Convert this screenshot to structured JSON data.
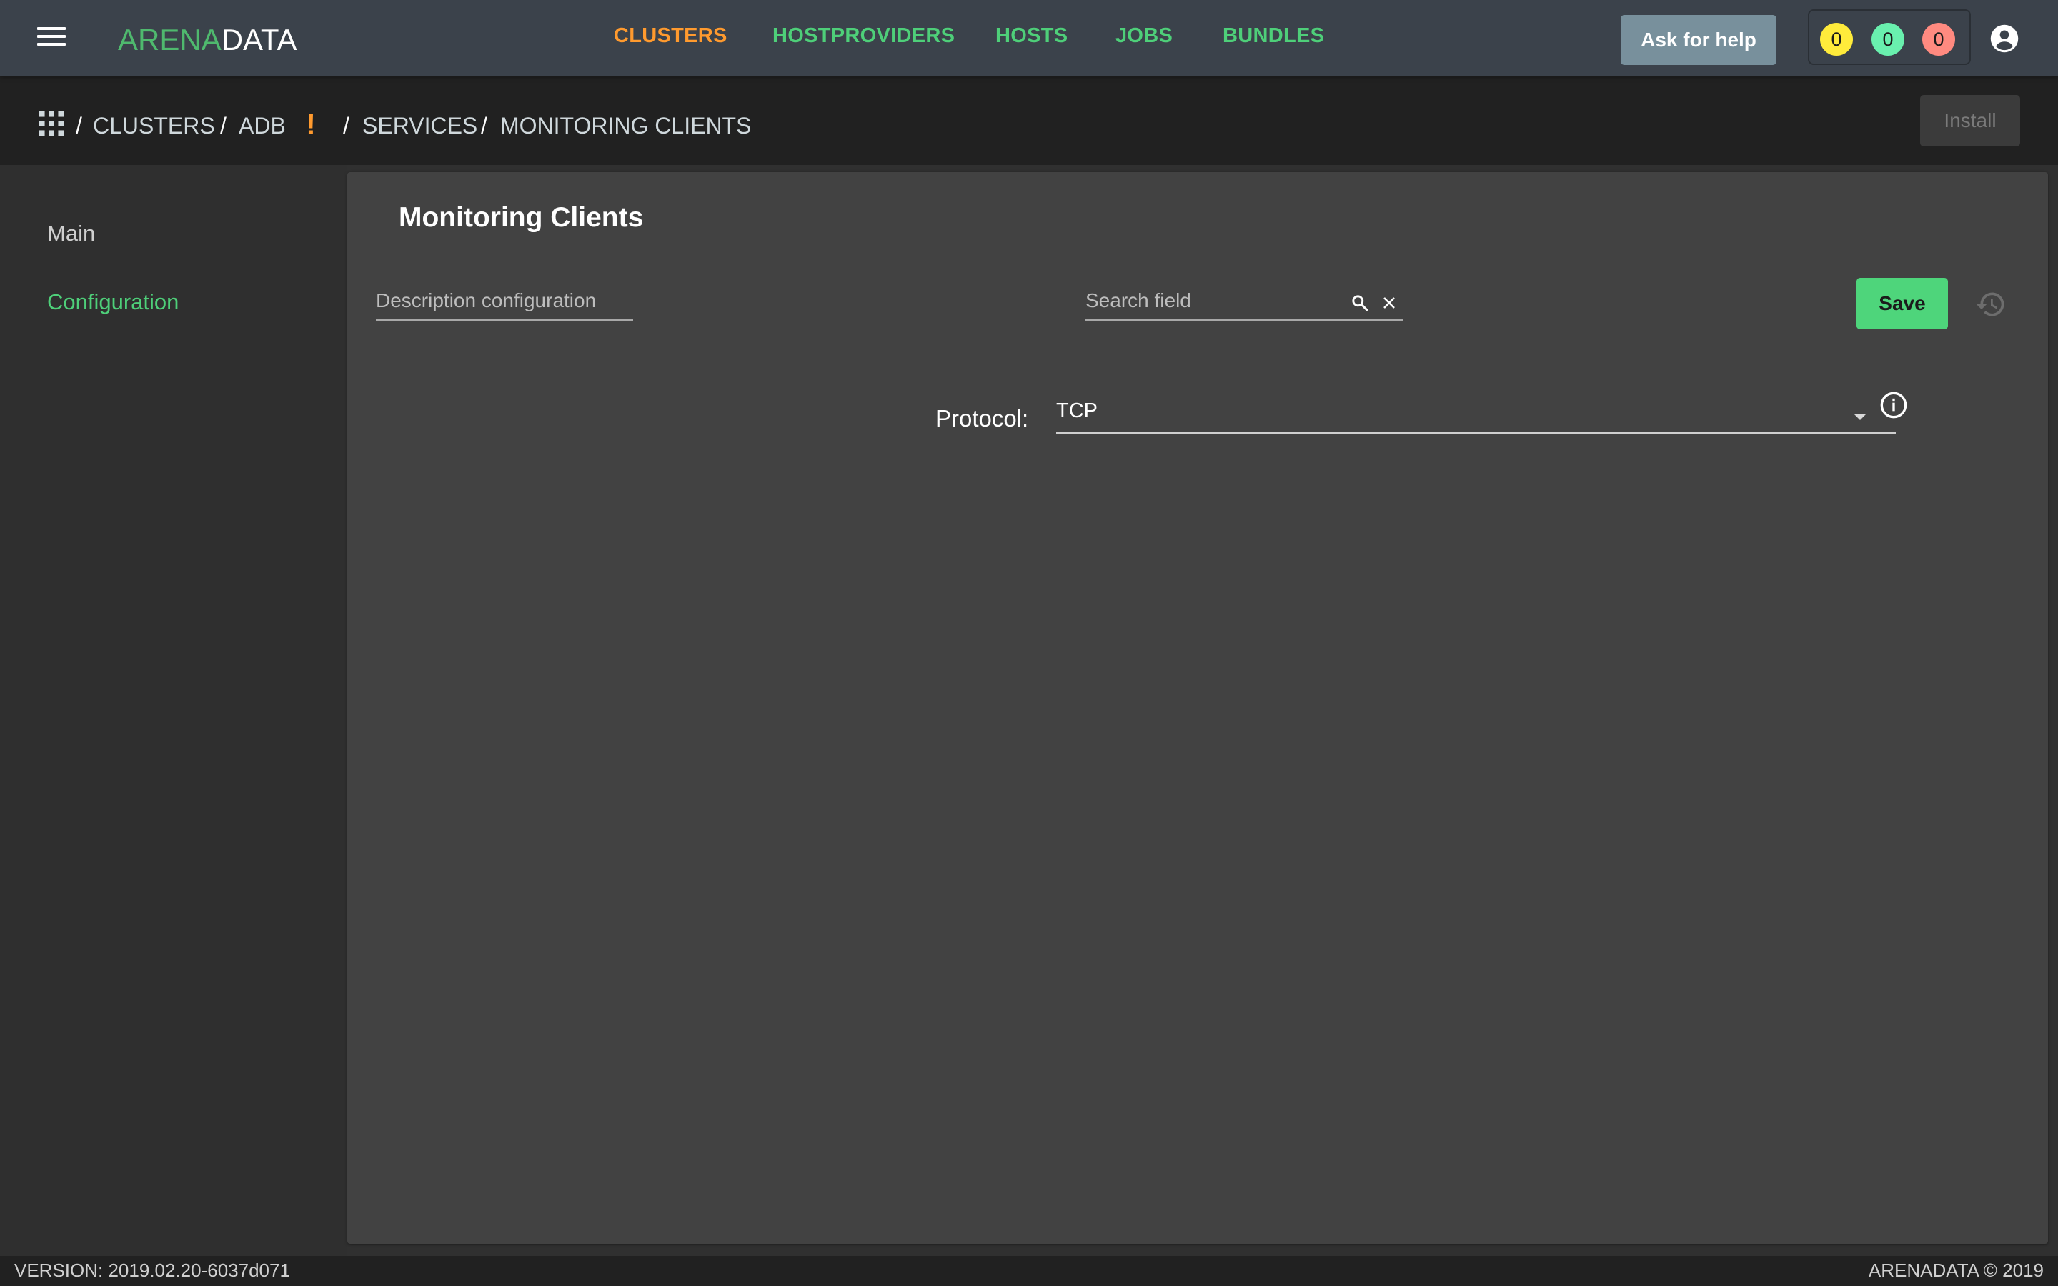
{
  "header": {
    "logo": {
      "part1": "ARENA",
      "part2": "DATA"
    },
    "nav": [
      {
        "label": "CLUSTERS",
        "active": true
      },
      {
        "label": "HOSTPROVIDERS",
        "active": false
      },
      {
        "label": "HOSTS",
        "active": false
      },
      {
        "label": "JOBS",
        "active": false
      },
      {
        "label": "BUNDLES",
        "active": false
      }
    ],
    "help_label": "Ask for help",
    "counters": [
      {
        "value": "0",
        "color": "#ffeb3b"
      },
      {
        "value": "0",
        "color": "#69f0ae"
      },
      {
        "value": "0",
        "color": "#ff8a80"
      }
    ]
  },
  "breadcrumb": {
    "items": [
      "CLUSTERS",
      "ADB",
      "SERVICES",
      "MONITORING CLIENTS"
    ],
    "separator": "/",
    "warning_mark": "!",
    "install_label": "Install"
  },
  "sidebar": {
    "items": [
      {
        "label": "Main",
        "active": false
      },
      {
        "label": "Configuration",
        "active": true
      }
    ]
  },
  "main": {
    "title": "Monitoring Clients",
    "description_placeholder": "Description configuration",
    "search_placeholder": "Search field",
    "save_label": "Save",
    "protocol_label": "Protocol:",
    "protocol_value": "TCP"
  },
  "footer": {
    "version": "VERSION: 2019.02.20-6037d071",
    "copyright": "ARENADATA © 2019"
  },
  "colors": {
    "accent_green": "#4ecf79",
    "accent_orange": "#ff9a2e"
  }
}
